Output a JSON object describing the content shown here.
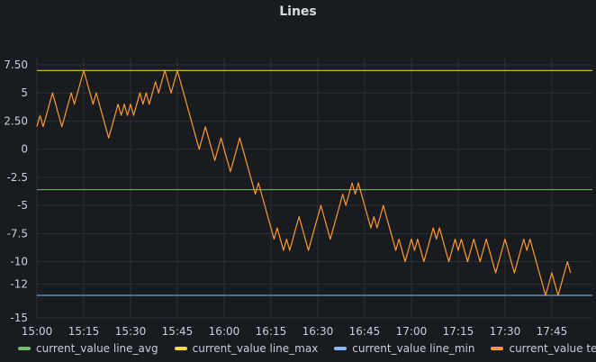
{
  "panel": {
    "title": "Lines"
  },
  "chart_data": {
    "type": "line",
    "title": "Lines",
    "xlabel": "",
    "ylabel": "",
    "xlim": [
      "15:00",
      "17:58"
    ],
    "ylim": [
      -15,
      7.5
    ],
    "x_ticks": [
      "15:00",
      "15:15",
      "15:30",
      "15:45",
      "16:00",
      "16:15",
      "16:30",
      "16:45",
      "17:00",
      "17:15",
      "17:30",
      "17:45"
    ],
    "y_ticks": [
      "7.50",
      "5",
      "2.50",
      "0",
      "-2.5",
      "-5",
      "-7.5",
      "-10",
      "-12",
      "-15"
    ],
    "grid": true,
    "legend_position": "bottom",
    "series": [
      {
        "name": "current_value line_avg",
        "color": "#73bf69",
        "kind": "constant",
        "value": -3.6
      },
      {
        "name": "current_value line_max",
        "color": "#fade2a",
        "kind": "constant",
        "value": 7
      },
      {
        "name": "current_value line_min",
        "color": "#8ab8ff",
        "kind": "constant",
        "value": -13
      },
      {
        "name": "current_value test",
        "color": "#ff9830",
        "kind": "line",
        "points": [
          [
            "15:00",
            2
          ],
          [
            "15:01",
            3
          ],
          [
            "15:02",
            2
          ],
          [
            "15:03",
            3
          ],
          [
            "15:04",
            4
          ],
          [
            "15:05",
            5
          ],
          [
            "15:06",
            4
          ],
          [
            "15:07",
            3
          ],
          [
            "15:08",
            2
          ],
          [
            "15:09",
            3
          ],
          [
            "15:10",
            4
          ],
          [
            "15:11",
            5
          ],
          [
            "15:12",
            4
          ],
          [
            "15:13",
            5
          ],
          [
            "15:14",
            6
          ],
          [
            "15:15",
            7
          ],
          [
            "15:16",
            6
          ],
          [
            "15:17",
            5
          ],
          [
            "15:18",
            4
          ],
          [
            "15:19",
            5
          ],
          [
            "15:20",
            4
          ],
          [
            "15:21",
            3
          ],
          [
            "15:22",
            2
          ],
          [
            "15:23",
            1
          ],
          [
            "15:24",
            2
          ],
          [
            "15:25",
            3
          ],
          [
            "15:26",
            4
          ],
          [
            "15:27",
            3
          ],
          [
            "15:28",
            4
          ],
          [
            "15:29",
            3
          ],
          [
            "15:30",
            4
          ],
          [
            "15:31",
            3
          ],
          [
            "15:32",
            4
          ],
          [
            "15:33",
            5
          ],
          [
            "15:34",
            4
          ],
          [
            "15:35",
            5
          ],
          [
            "15:36",
            4
          ],
          [
            "15:37",
            5
          ],
          [
            "15:38",
            6
          ],
          [
            "15:39",
            5
          ],
          [
            "15:40",
            6
          ],
          [
            "15:41",
            7
          ],
          [
            "15:42",
            6
          ],
          [
            "15:43",
            5
          ],
          [
            "15:44",
            6
          ],
          [
            "15:45",
            7
          ],
          [
            "15:46",
            6
          ],
          [
            "15:47",
            5
          ],
          [
            "15:48",
            4
          ],
          [
            "15:49",
            3
          ],
          [
            "15:50",
            2
          ],
          [
            "15:51",
            1
          ],
          [
            "15:52",
            0
          ],
          [
            "15:53",
            1
          ],
          [
            "15:54",
            2
          ],
          [
            "15:55",
            1
          ],
          [
            "15:56",
            0
          ],
          [
            "15:57",
            -1
          ],
          [
            "15:58",
            0
          ],
          [
            "15:59",
            1
          ],
          [
            "16:00",
            0
          ],
          [
            "16:01",
            -1
          ],
          [
            "16:02",
            -2
          ],
          [
            "16:03",
            -1
          ],
          [
            "16:04",
            0
          ],
          [
            "16:05",
            1
          ],
          [
            "16:06",
            0
          ],
          [
            "16:07",
            -1
          ],
          [
            "16:08",
            -2
          ],
          [
            "16:09",
            -3
          ],
          [
            "16:10",
            -4
          ],
          [
            "16:11",
            -3
          ],
          [
            "16:12",
            -4
          ],
          [
            "16:13",
            -5
          ],
          [
            "16:14",
            -6
          ],
          [
            "16:15",
            -7
          ],
          [
            "16:16",
            -8
          ],
          [
            "16:17",
            -7
          ],
          [
            "16:18",
            -8
          ],
          [
            "16:19",
            -9
          ],
          [
            "16:20",
            -8
          ],
          [
            "16:21",
            -9
          ],
          [
            "16:22",
            -8
          ],
          [
            "16:23",
            -7
          ],
          [
            "16:24",
            -6
          ],
          [
            "16:25",
            -7
          ],
          [
            "16:26",
            -8
          ],
          [
            "16:27",
            -9
          ],
          [
            "16:28",
            -8
          ],
          [
            "16:29",
            -7
          ],
          [
            "16:30",
            -6
          ],
          [
            "16:31",
            -5
          ],
          [
            "16:32",
            -6
          ],
          [
            "16:33",
            -7
          ],
          [
            "16:34",
            -8
          ],
          [
            "16:35",
            -7
          ],
          [
            "16:36",
            -6
          ],
          [
            "16:37",
            -5
          ],
          [
            "16:38",
            -4
          ],
          [
            "16:39",
            -5
          ],
          [
            "16:40",
            -4
          ],
          [
            "16:41",
            -3
          ],
          [
            "16:42",
            -4
          ],
          [
            "16:43",
            -3
          ],
          [
            "16:44",
            -4
          ],
          [
            "16:45",
            -5
          ],
          [
            "16:46",
            -6
          ],
          [
            "16:47",
            -7
          ],
          [
            "16:48",
            -6
          ],
          [
            "16:49",
            -7
          ],
          [
            "16:50",
            -6
          ],
          [
            "16:51",
            -5
          ],
          [
            "16:52",
            -6
          ],
          [
            "16:53",
            -7
          ],
          [
            "16:54",
            -8
          ],
          [
            "16:55",
            -9
          ],
          [
            "16:56",
            -8
          ],
          [
            "16:57",
            -9
          ],
          [
            "16:58",
            -10
          ],
          [
            "16:59",
            -9
          ],
          [
            "17:00",
            -8
          ],
          [
            "17:01",
            -9
          ],
          [
            "17:02",
            -8
          ],
          [
            "17:03",
            -9
          ],
          [
            "17:04",
            -10
          ],
          [
            "17:05",
            -9
          ],
          [
            "17:06",
            -8
          ],
          [
            "17:07",
            -7
          ],
          [
            "17:08",
            -8
          ],
          [
            "17:09",
            -7
          ],
          [
            "17:10",
            -8
          ],
          [
            "17:11",
            -9
          ],
          [
            "17:12",
            -10
          ],
          [
            "17:13",
            -9
          ],
          [
            "17:14",
            -8
          ],
          [
            "17:15",
            -9
          ],
          [
            "17:16",
            -8
          ],
          [
            "17:17",
            -9
          ],
          [
            "17:18",
            -10
          ],
          [
            "17:19",
            -9
          ],
          [
            "17:20",
            -8
          ],
          [
            "17:21",
            -9
          ],
          [
            "17:22",
            -10
          ],
          [
            "17:23",
            -9
          ],
          [
            "17:24",
            -8
          ],
          [
            "17:25",
            -9
          ],
          [
            "17:26",
            -10
          ],
          [
            "17:27",
            -11
          ],
          [
            "17:28",
            -10
          ],
          [
            "17:29",
            -9
          ],
          [
            "17:30",
            -8
          ],
          [
            "17:31",
            -9
          ],
          [
            "17:32",
            -10
          ],
          [
            "17:33",
            -11
          ],
          [
            "17:34",
            -10
          ],
          [
            "17:35",
            -9
          ],
          [
            "17:36",
            -8
          ],
          [
            "17:37",
            -9
          ],
          [
            "17:38",
            -8
          ],
          [
            "17:39",
            -9
          ],
          [
            "17:40",
            -10
          ],
          [
            "17:41",
            -11
          ],
          [
            "17:42",
            -12
          ],
          [
            "17:43",
            -13
          ],
          [
            "17:44",
            -12
          ],
          [
            "17:45",
            -11
          ],
          [
            "17:46",
            -12
          ],
          [
            "17:47",
            -13
          ],
          [
            "17:48",
            -12
          ],
          [
            "17:49",
            -11
          ],
          [
            "17:50",
            -10
          ],
          [
            "17:51",
            -11
          ]
        ]
      }
    ]
  }
}
